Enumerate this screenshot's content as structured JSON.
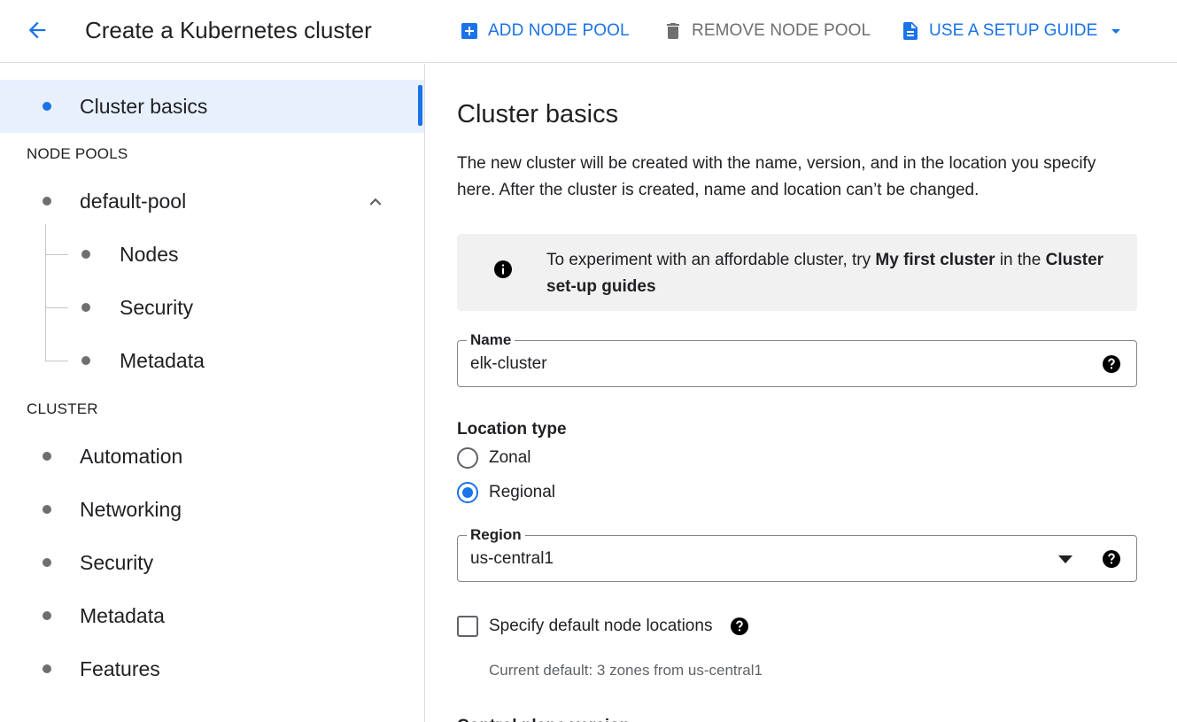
{
  "header": {
    "title": "Create a Kubernetes cluster",
    "add_node_pool": "ADD NODE POOL",
    "remove_node_pool": "REMOVE NODE POOL",
    "use_setup_guide": "USE A SETUP GUIDE",
    "icons": {
      "back": "arrow-back-icon",
      "add": "add-box-icon",
      "remove": "delete-icon",
      "guide": "document-icon",
      "guide_dropdown": "caret-down-icon"
    }
  },
  "sidebar": {
    "cluster_basics": "Cluster basics",
    "node_pools_heading": "NODE POOLS",
    "default_pool": "default-pool",
    "pool_items": [
      "Nodes",
      "Security",
      "Metadata"
    ],
    "cluster_heading": "CLUSTER",
    "cluster_items": [
      "Automation",
      "Networking",
      "Security",
      "Metadata",
      "Features"
    ]
  },
  "main": {
    "title": "Cluster basics",
    "description": "The new cluster will be created with the name, version, and in the location you specify here. After the cluster is created, name and location can’t be changed.",
    "info": {
      "prefix": "To experiment with an affordable cluster, try ",
      "link1": "My first cluster",
      "middle": " in the ",
      "link2": "Cluster set-up guides"
    },
    "name_field": {
      "label": "Name",
      "value": "elk-cluster"
    },
    "location_type": {
      "label": "Location type",
      "options": [
        "Zonal",
        "Regional"
      ],
      "selected": "Regional"
    },
    "region_field": {
      "label": "Region",
      "value": "us-central1"
    },
    "node_locations": {
      "label": "Specify default node locations",
      "checked": false,
      "current_default": "Current default: 3 zones from us-central1"
    },
    "cutoff_heading": "Control plane version"
  },
  "colors": {
    "accent": "#1a73e8",
    "active_bg": "#e8f0fe",
    "info_bg": "#f1f1f1",
    "muted": "#6f6f6f"
  }
}
